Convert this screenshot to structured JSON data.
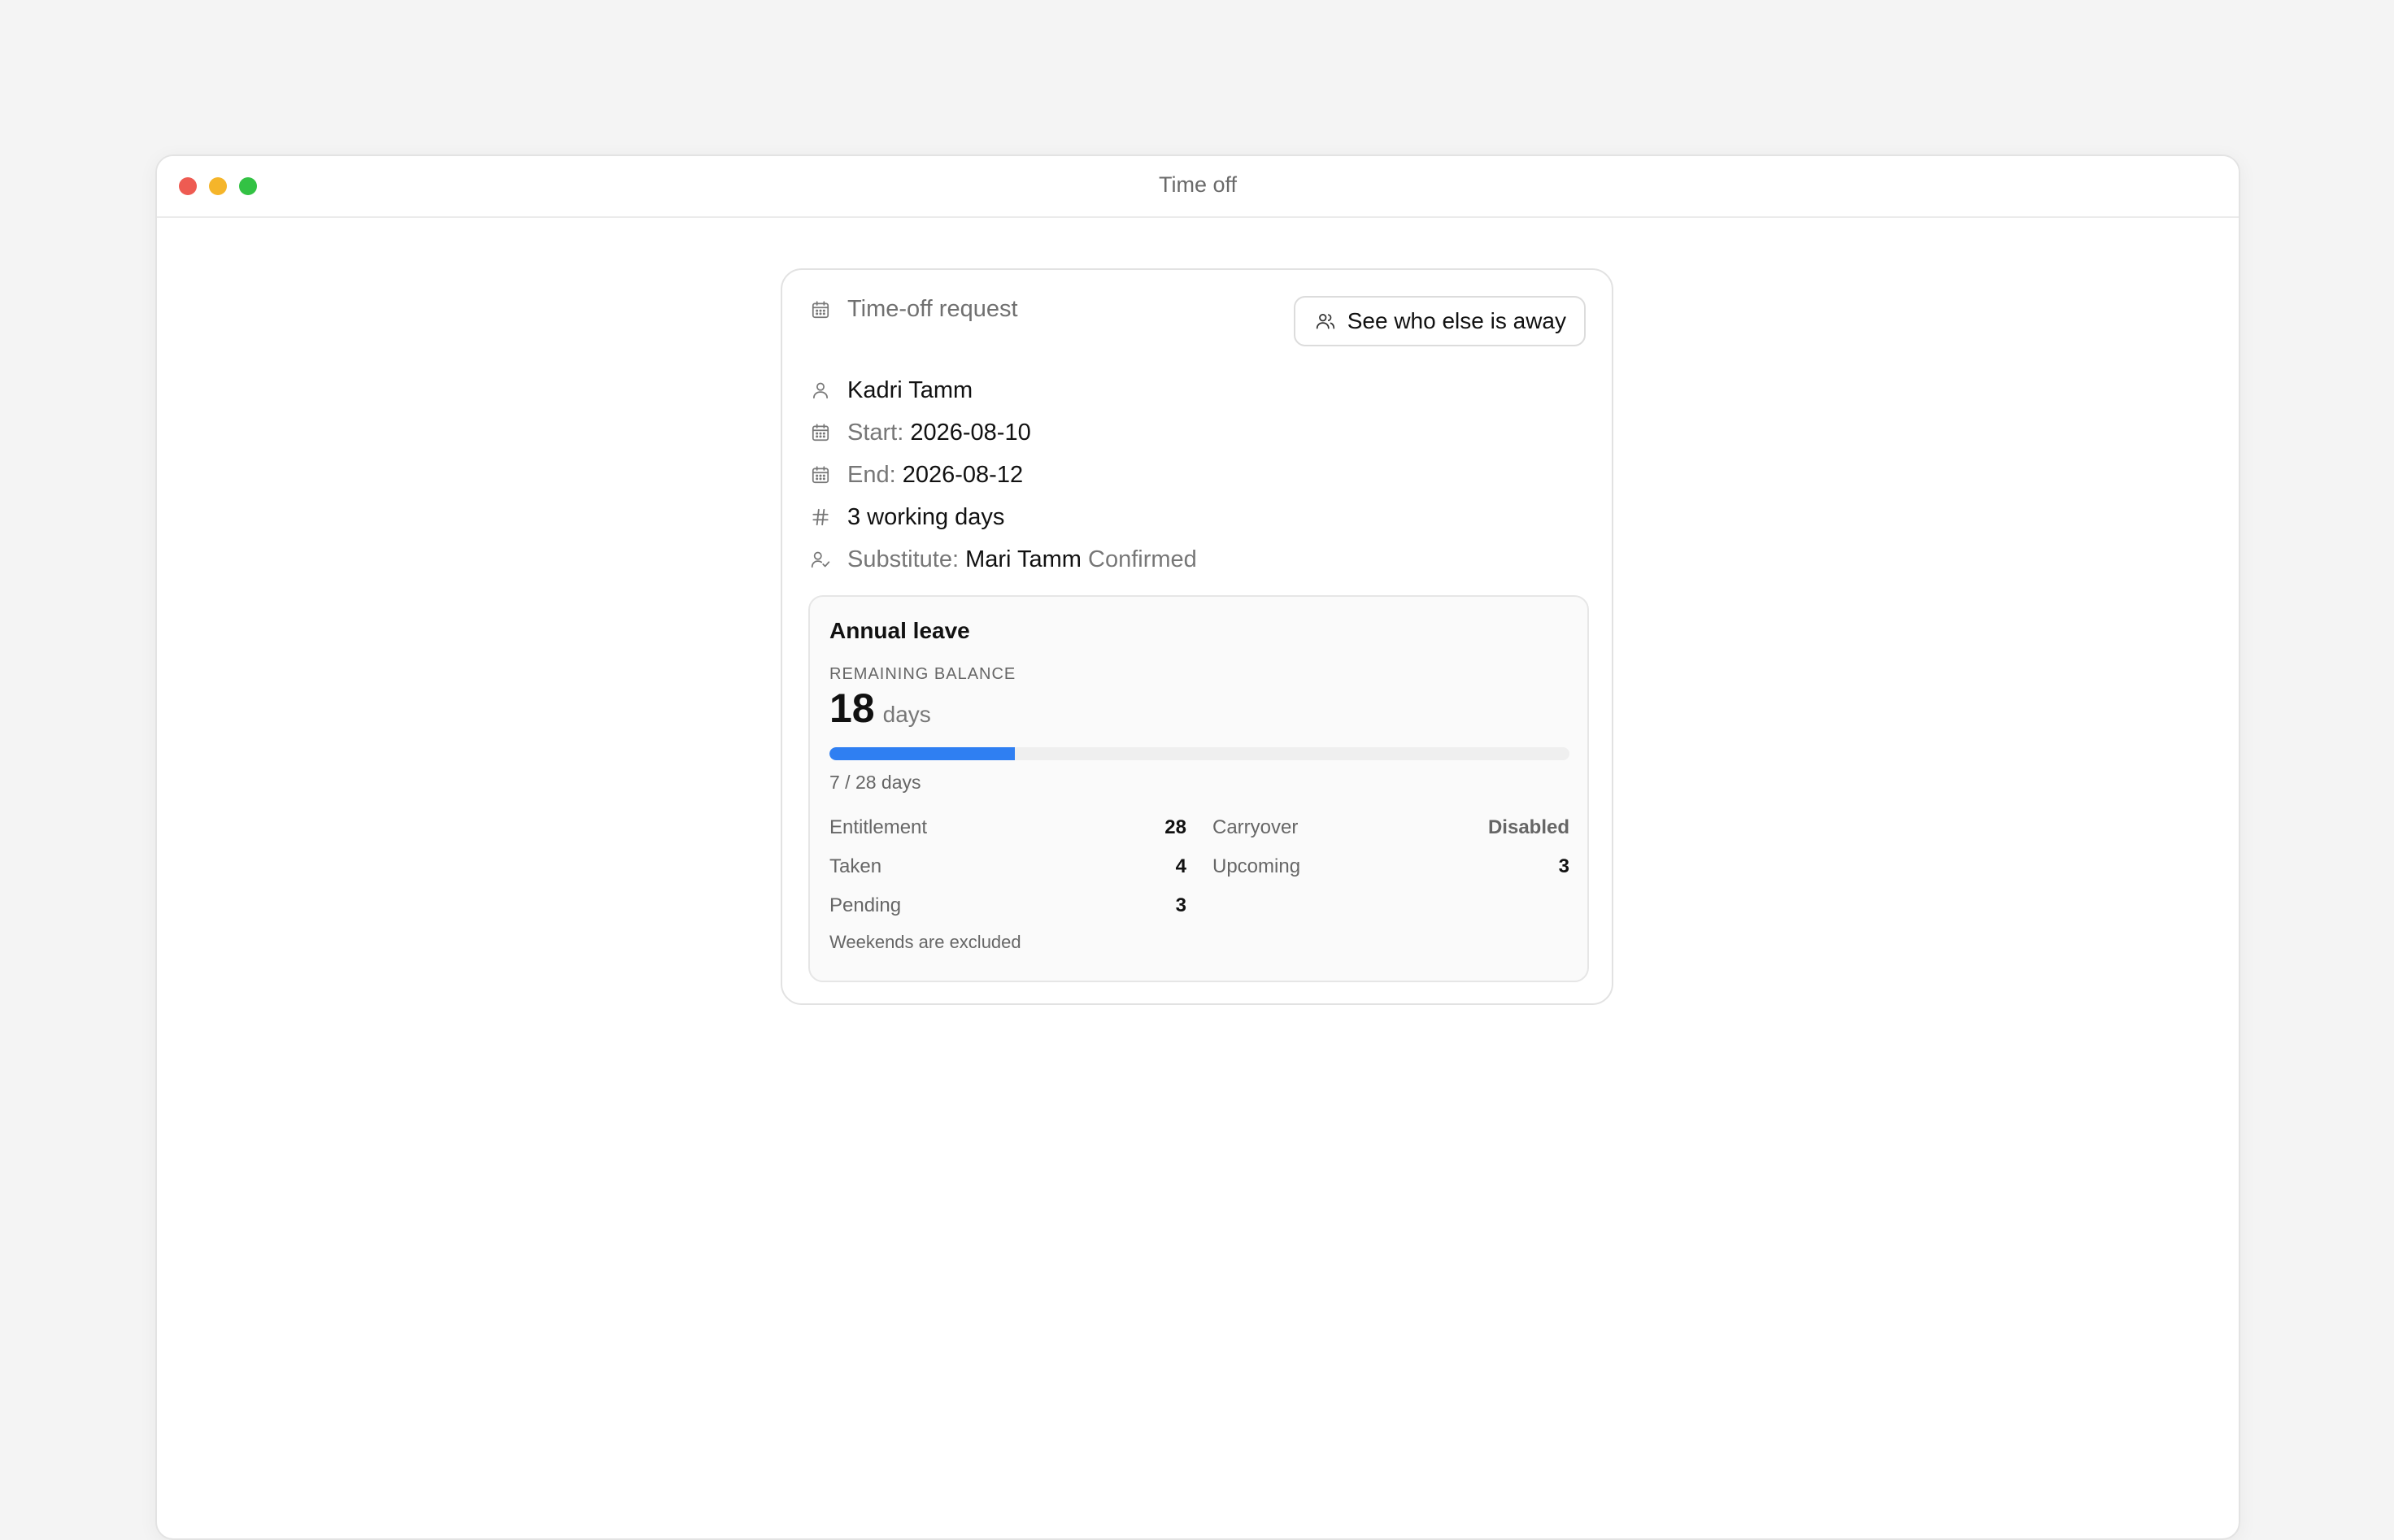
{
  "window": {
    "title": "Time off",
    "traffic_lights": {
      "close": "#ee5b52",
      "minimize": "#f5b52a",
      "maximize": "#33c244"
    }
  },
  "card": {
    "header": {
      "icon": "calendar-icon",
      "title": "Time-off request"
    },
    "away_button": {
      "icon": "users-icon",
      "label": "See who else is away"
    },
    "employee": {
      "icon": "user-icon",
      "name": "Kadri Tamm"
    },
    "start": {
      "icon": "calendar-icon",
      "label": "Start:",
      "value": "2026-08-10"
    },
    "end": {
      "icon": "calendar-icon",
      "label": "End:",
      "value": "2026-08-12"
    },
    "working_days": {
      "icon": "hash-icon",
      "value": "3 working days"
    },
    "substitute": {
      "icon": "user-check-icon",
      "label": "Substitute:",
      "name": "Mari Tamm",
      "status": "Confirmed"
    }
  },
  "leave": {
    "title": "Annual leave",
    "balance_label": "REMAINING BALANCE",
    "balance_value": "18",
    "balance_unit": "days",
    "progress": {
      "used": 7,
      "total": 28,
      "caption": "7 / 28 days",
      "color": "#2f7ff2"
    },
    "stats_left": [
      {
        "label": "Entitlement",
        "value": "28"
      },
      {
        "label": "Taken",
        "value": "4"
      },
      {
        "label": "Pending",
        "value": "3"
      }
    ],
    "stats_right": [
      {
        "label": "Carryover",
        "value": "Disabled"
      },
      {
        "label": "Upcoming",
        "value": "3"
      }
    ],
    "footnote": "Weekends are excluded"
  }
}
